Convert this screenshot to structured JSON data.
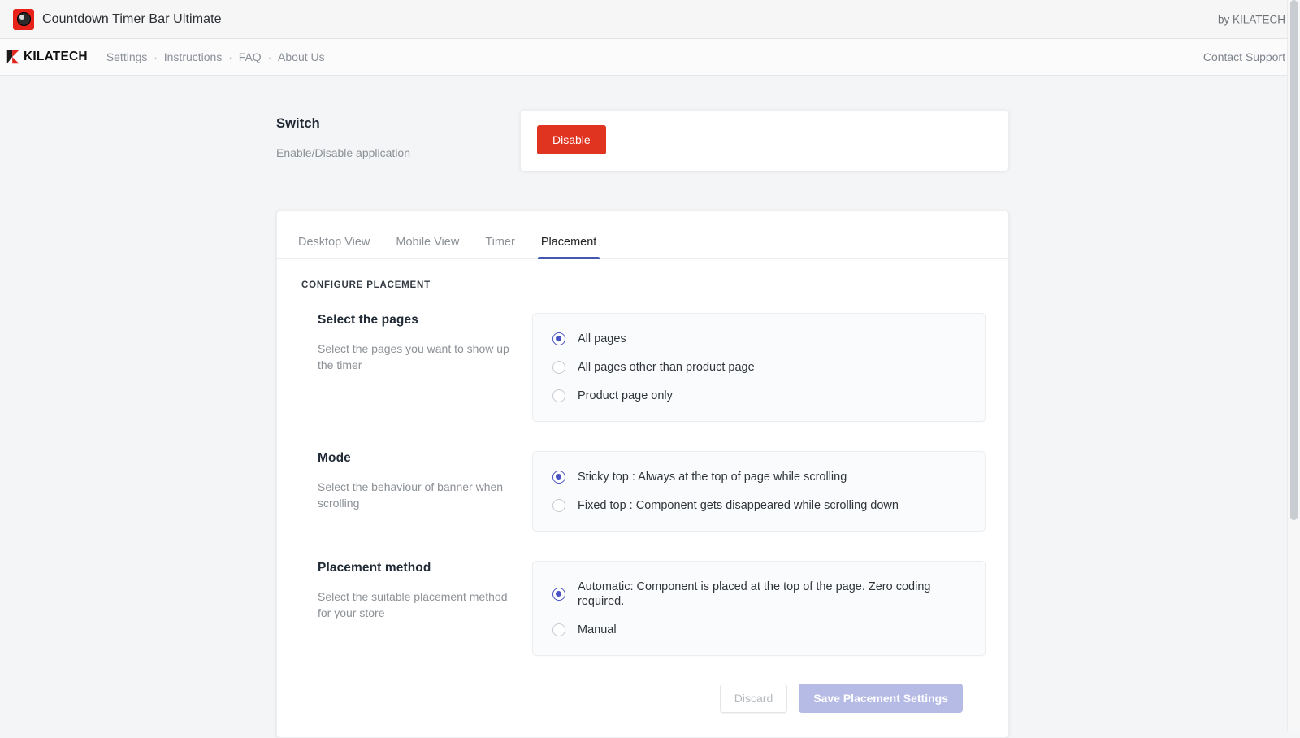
{
  "titlebar": {
    "app_icon": "countdown-timer-icon",
    "title": "Countdown Timer Bar Ultimate",
    "byline": "by KILATECH"
  },
  "navbar": {
    "brand_mark": "kilatech-k-logo",
    "brand_name": "KILATECH",
    "links": [
      {
        "label": "Settings"
      },
      {
        "label": "Instructions"
      },
      {
        "label": "FAQ"
      },
      {
        "label": "About Us"
      }
    ],
    "separator": "·",
    "contact_support": "Contact Support"
  },
  "switch_section": {
    "title": "Switch",
    "description": "Enable/Disable application",
    "button_label": "Disable",
    "button_color": "#e03421"
  },
  "tab_card": {
    "tabs": [
      {
        "label": "Desktop View",
        "active": false
      },
      {
        "label": "Mobile View",
        "active": false
      },
      {
        "label": "Timer",
        "active": false
      },
      {
        "label": "Placement",
        "active": true
      }
    ],
    "active_tab_color": "#4558b0",
    "heading": "CONFIGURE PLACEMENT",
    "settings": [
      {
        "title": "Select the pages",
        "description": "Select the pages you want to show up the timer",
        "options": [
          {
            "label": "All pages",
            "selected": true
          },
          {
            "label": "All pages other than product page",
            "selected": false
          },
          {
            "label": "Product page only",
            "selected": false
          }
        ]
      },
      {
        "title": "Mode",
        "description": "Select the behaviour of banner when scrolling",
        "options": [
          {
            "label": "Sticky top : Always at the top of page while scrolling",
            "selected": true
          },
          {
            "label": "Fixed top : Component gets disappeared while scrolling down",
            "selected": false
          }
        ]
      },
      {
        "title": "Placement method",
        "description": "Select the suitable placement method for your store",
        "options": [
          {
            "label": "Automatic: Component is placed at the top of the page. Zero coding required.",
            "selected": true
          },
          {
            "label": "Manual",
            "selected": false
          }
        ]
      }
    ],
    "actions": {
      "discard_label": "Discard",
      "save_label": "Save Placement Settings",
      "save_color": "#b6bbe6"
    },
    "radio_selected_color": "#4a53c4"
  }
}
